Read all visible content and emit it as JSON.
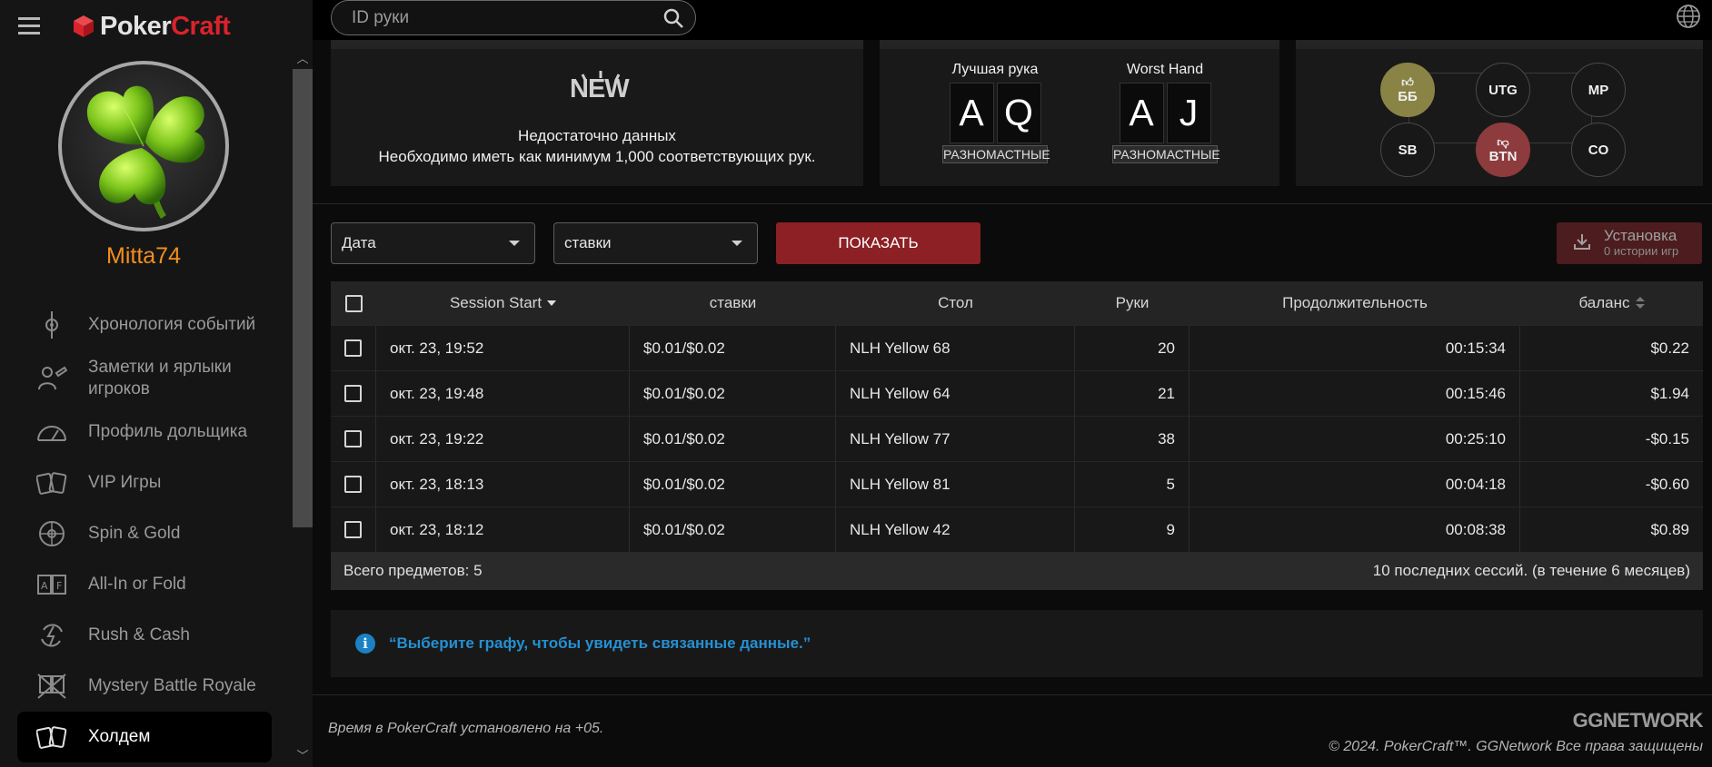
{
  "app": {
    "logo_part1": "Poker",
    "logo_part2": "Craft",
    "brand_red": "#d9232d"
  },
  "profile": {
    "username": "Mitta74",
    "avatar_icon": "clover-icon"
  },
  "sidebar": {
    "items": [
      {
        "label": "Хронология событий",
        "icon": "timeline-icon",
        "active": false
      },
      {
        "label": "Заметки и ярлыки игроков",
        "icon": "notes-icon",
        "active": false
      },
      {
        "label": "Профиль дольщика",
        "icon": "gauge-icon",
        "active": false
      },
      {
        "label": "VIP Игры",
        "icon": "cards-icon",
        "active": false
      },
      {
        "label": "Spin & Gold",
        "icon": "wheel-icon",
        "active": false
      },
      {
        "label": "All-In or Fold",
        "icon": "allin-fold-icon",
        "active": false
      },
      {
        "label": "Rush & Cash",
        "icon": "rush-icon",
        "active": false
      },
      {
        "label": "Mystery Battle Royale",
        "icon": "battle-icon",
        "active": false
      },
      {
        "label": "Холдем",
        "icon": "cards-icon",
        "active": true
      }
    ]
  },
  "search": {
    "placeholder": "ID руки",
    "value": ""
  },
  "panels": {
    "new_badge": "NEW",
    "not_enough_1": "Недостаточно данных",
    "not_enough_2": "Необходимо иметь как минимум 1,000 соответствующих рук.",
    "best_hand": {
      "title": "Лучшая рука",
      "cards": [
        "A",
        "Q"
      ],
      "type": "РАЗНОМАСТНЫЕ"
    },
    "worst_hand": {
      "title": "Worst Hand",
      "cards": [
        "A",
        "J"
      ],
      "type": "РАЗНОМАСТНЫЕ"
    },
    "positions": {
      "bb": "ББ",
      "utg": "UTG",
      "mp": "MP",
      "sb": "SB",
      "btn": "BTN",
      "co": "CO",
      "good_color": "#8a8346",
      "bad_color": "#8d3b3d"
    }
  },
  "filters": {
    "date_label": "Дата",
    "stakes_label": "ставки",
    "show_button": "ПОКАЗАТЬ",
    "install_title": "Установка",
    "install_sub": "0 истории игр"
  },
  "table": {
    "headers": [
      "Session Start",
      "ставки",
      "Стол",
      "Руки",
      "Продолжительность",
      "баланс"
    ],
    "rows": [
      [
        "окт. 23, 19:52",
        "$0.01/$0.02",
        "NLH Yellow 68",
        "20",
        "00:15:34",
        "$0.22"
      ],
      [
        "окт. 23, 19:48",
        "$0.01/$0.02",
        "NLH Yellow 64",
        "21",
        "00:15:46",
        "$1.94"
      ],
      [
        "окт. 23, 19:22",
        "$0.01/$0.02",
        "NLH Yellow 77",
        "38",
        "00:25:10",
        "-$0.15"
      ],
      [
        "окт. 23, 18:13",
        "$0.01/$0.02",
        "NLH Yellow 81",
        "5",
        "00:04:18",
        "-$0.60"
      ],
      [
        "окт. 23, 18:12",
        "$0.01/$0.02",
        "NLH Yellow 42",
        "9",
        "00:08:38",
        "$0.89"
      ]
    ],
    "total": "Всего предметов: 5",
    "period": "10 последних сессий. (в течение 6 месяцев)"
  },
  "info": {
    "text": "“Выберите графу, чтобы увидеть связанные данные.”",
    "color": "#2590d2"
  },
  "footer": {
    "time_note": "Время в PokerCraft установлено на +05.",
    "network_logo": "GGNETWORK",
    "copyright": "© 2024. PokerCraft™. GGNetwork Все права защищены"
  }
}
